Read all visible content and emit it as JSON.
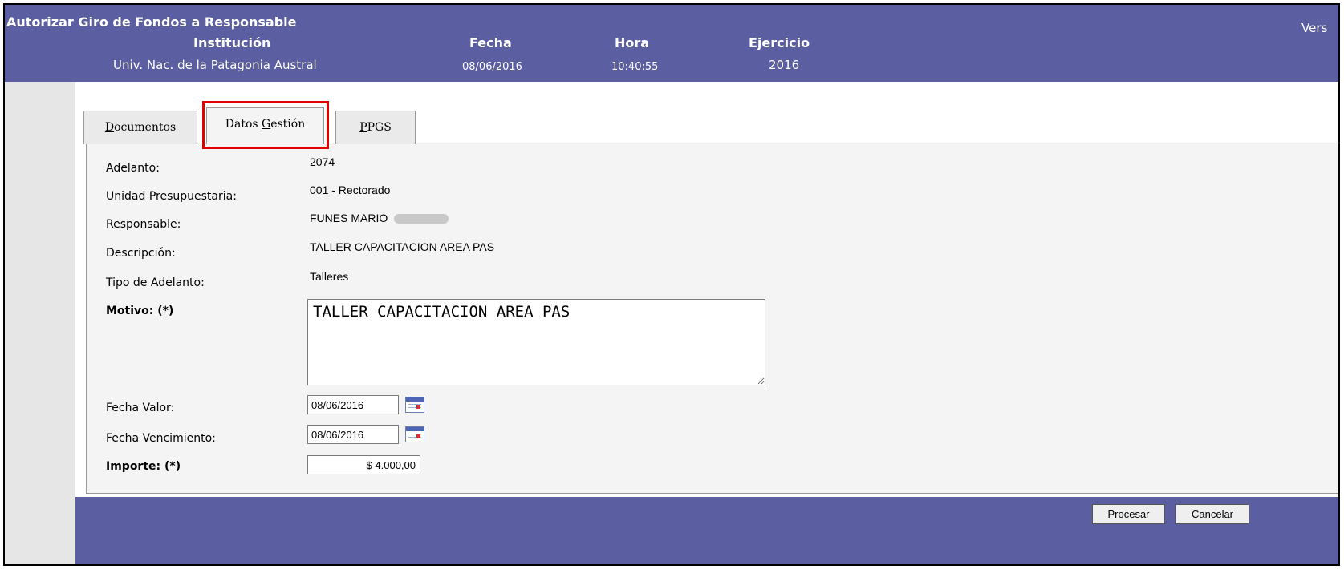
{
  "header": {
    "title": "Autorizar Giro de Fondos a Responsable",
    "version_label": "Vers",
    "columns": [
      {
        "label": "Institución",
        "value": "Univ. Nac. de la Patagonia Austral"
      },
      {
        "label": "Fecha",
        "value": "08/06/2016"
      },
      {
        "label": "Hora",
        "value": "10:40:55"
      },
      {
        "label": "Ejercicio",
        "value": "2016"
      }
    ]
  },
  "tabs": [
    {
      "pre": "",
      "key": "D",
      "post": "ocumentos"
    },
    {
      "pre": "Datos ",
      "key": "G",
      "post": "estión"
    },
    {
      "pre": "",
      "key": "P",
      "post": "PGS"
    }
  ],
  "active_tab_index": 1,
  "highlight_color": "#e00000",
  "fields": {
    "adelanto": {
      "label": "Adelanto:",
      "value": "2074"
    },
    "unidad": {
      "label": "Unidad Presupuestaria:",
      "value": "001 - Rectorado"
    },
    "responsable": {
      "label": "Responsable:",
      "value": "FUNES MARIO"
    },
    "descripcion": {
      "label": "Descripción:",
      "value": "TALLER CAPACITACION AREA PAS"
    },
    "tipo": {
      "label": "Tipo de Adelanto:",
      "value": "Talleres"
    },
    "motivo": {
      "label": "Motivo: (*)",
      "value": "TALLER CAPACITACION AREA PAS"
    },
    "fecha_valor": {
      "label": "Fecha Valor:",
      "value": "08/06/2016"
    },
    "fecha_vencimiento": {
      "label": "Fecha Vencimiento:",
      "value": "08/06/2016"
    },
    "importe": {
      "label": "Importe: (*)",
      "value": "$ 4.000,00"
    }
  },
  "buttons": {
    "procesar": {
      "pre": "",
      "key": "P",
      "post": "rocesar"
    },
    "cancelar": {
      "pre": "",
      "key": "C",
      "post": "ancelar"
    }
  },
  "colors": {
    "header_bg": "#5b5ea0",
    "panel_bg": "#f4f4f4",
    "page_bg": "#e6e6e6"
  }
}
